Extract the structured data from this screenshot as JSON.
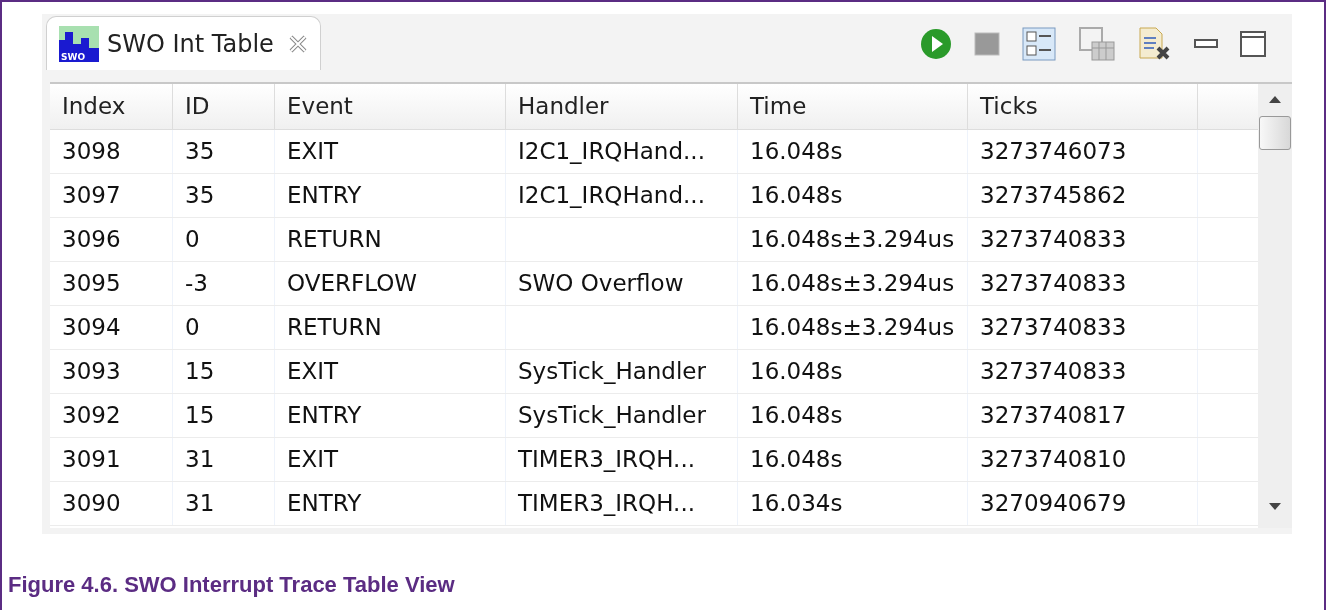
{
  "view": {
    "tab": {
      "title": "SWO Int Table",
      "icon_label": "SWO",
      "selected": true
    }
  },
  "table": {
    "columns": [
      "Index",
      "ID",
      "Event",
      "Handler",
      "Time",
      "Ticks"
    ],
    "rows": [
      [
        "3098",
        "35",
        "EXIT",
        "I2C1_IRQHand...",
        "16.048s",
        "3273746073"
      ],
      [
        "3097",
        "35",
        "ENTRY",
        "I2C1_IRQHand...",
        "16.048s",
        "3273745862"
      ],
      [
        "3096",
        "0",
        "RETURN",
        "",
        "16.048s±3.294us",
        "3273740833"
      ],
      [
        "3095",
        "-3",
        "OVERFLOW",
        "SWO Overflow",
        "16.048s±3.294us",
        "3273740833"
      ],
      [
        "3094",
        "0",
        "RETURN",
        "",
        "16.048s±3.294us",
        "3273740833"
      ],
      [
        "3093",
        "15",
        "EXIT",
        "SysTick_Handler",
        "16.048s",
        "3273740833"
      ],
      [
        "3092",
        "15",
        "ENTRY",
        "SysTick_Handler",
        "16.048s",
        "3273740817"
      ],
      [
        "3091",
        "31",
        "EXIT",
        "TIMER3_IRQH...",
        "16.048s",
        "3273740810"
      ],
      [
        "3090",
        "31",
        "ENTRY",
        "TIMER3_IRQH...",
        "16.034s",
        "3270940679"
      ]
    ]
  },
  "caption": "Figure 4.6. SWO Interrupt Trace Table View"
}
